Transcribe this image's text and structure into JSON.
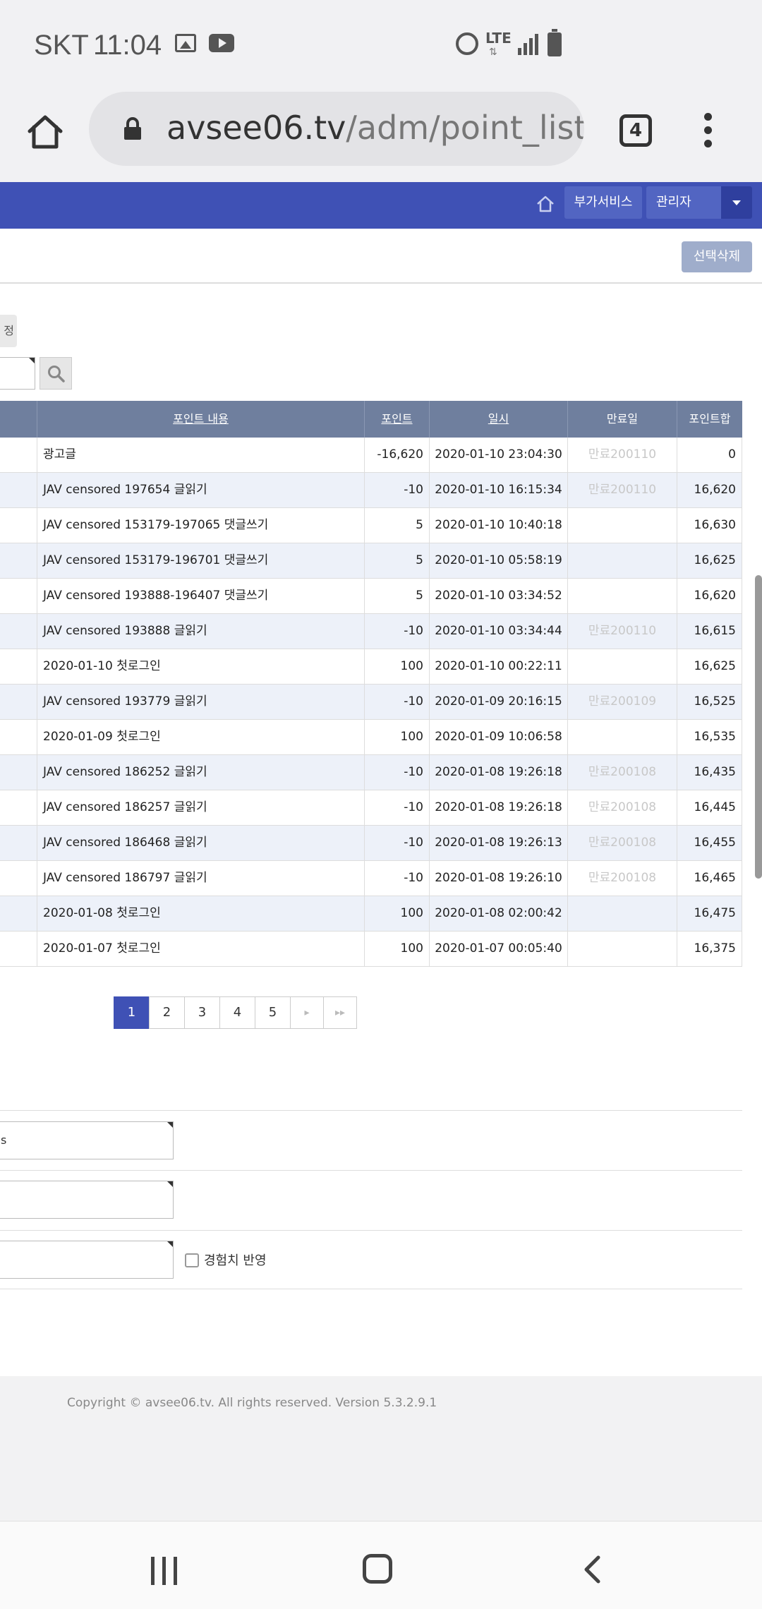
{
  "status_bar": {
    "carrier": "SKT",
    "time": "11:04",
    "network": "LTE"
  },
  "browser": {
    "url_host": "avsee06.tv",
    "url_path": "/adm/point_list.p",
    "tab_count": "4"
  },
  "admin_header": {
    "service_label": "부가서비스",
    "admin_label": "관리자"
  },
  "top_actions": {
    "delete_selected_label": "선택삭제",
    "partial_button_label": "정"
  },
  "table": {
    "headers": [
      "포인트 내용",
      "포인트",
      "일시",
      "만료일",
      "포인트합"
    ],
    "rows": [
      {
        "content": "광고글",
        "point": "-16,620",
        "datetime": "2020-01-10 23:04:30",
        "expire": "만료200110",
        "total": "0"
      },
      {
        "content": "JAV censored 197654 글읽기",
        "point": "-10",
        "datetime": "2020-01-10 16:15:34",
        "expire": "만료200110",
        "total": "16,620"
      },
      {
        "content": "JAV censored 153179-197065 댓글쓰기",
        "point": "5",
        "datetime": "2020-01-10 10:40:18",
        "expire": "",
        "total": "16,630"
      },
      {
        "content": "JAV censored 153179-196701 댓글쓰기",
        "point": "5",
        "datetime": "2020-01-10 05:58:19",
        "expire": "",
        "total": "16,625"
      },
      {
        "content": "JAV censored 193888-196407 댓글쓰기",
        "point": "5",
        "datetime": "2020-01-10 03:34:52",
        "expire": "",
        "total": "16,620"
      },
      {
        "content": "JAV censored 193888 글읽기",
        "point": "-10",
        "datetime": "2020-01-10 03:34:44",
        "expire": "만료200110",
        "total": "16,615"
      },
      {
        "content": "2020-01-10 첫로그인",
        "point": "100",
        "datetime": "2020-01-10 00:22:11",
        "expire": "",
        "total": "16,625"
      },
      {
        "content": "JAV censored 193779 글읽기",
        "point": "-10",
        "datetime": "2020-01-09 20:16:15",
        "expire": "만료200109",
        "total": "16,525"
      },
      {
        "content": "2020-01-09 첫로그인",
        "point": "100",
        "datetime": "2020-01-09 10:06:58",
        "expire": "",
        "total": "16,535"
      },
      {
        "content": "JAV censored 186252 글읽기",
        "point": "-10",
        "datetime": "2020-01-08 19:26:18",
        "expire": "만료200108",
        "total": "16,435"
      },
      {
        "content": "JAV censored 186257 글읽기",
        "point": "-10",
        "datetime": "2020-01-08 19:26:18",
        "expire": "만료200108",
        "total": "16,445"
      },
      {
        "content": "JAV censored 186468 글읽기",
        "point": "-10",
        "datetime": "2020-01-08 19:26:13",
        "expire": "만료200108",
        "total": "16,455"
      },
      {
        "content": "JAV censored 186797 글읽기",
        "point": "-10",
        "datetime": "2020-01-08 19:26:10",
        "expire": "만료200108",
        "total": "16,465"
      },
      {
        "content": "2020-01-08 첫로그인",
        "point": "100",
        "datetime": "2020-01-08 02:00:42",
        "expire": "",
        "total": "16,475"
      },
      {
        "content": "2020-01-07 첫로그인",
        "point": "100",
        "datetime": "2020-01-07 00:05:40",
        "expire": "",
        "total": "16,375"
      }
    ]
  },
  "pagination": {
    "pages": [
      "1",
      "2",
      "3",
      "4",
      "5"
    ],
    "active": "1",
    "next_label": "▸",
    "last_label": "▸▸"
  },
  "form": {
    "field1_value": "s",
    "checkbox_label": "경험치 반영"
  },
  "footer": {
    "copyright": "Copyright © avsee06.tv. All rights reserved. Version 5.3.2.9.1"
  }
}
